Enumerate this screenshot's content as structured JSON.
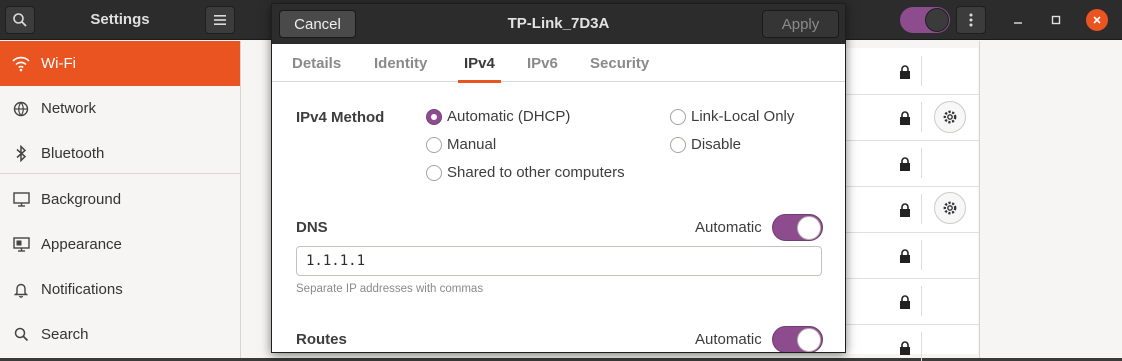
{
  "settings_window": {
    "title": "Settings",
    "sidebar_items": [
      {
        "label": "Wi-Fi",
        "icon": "wifi-icon",
        "active": true
      },
      {
        "label": "Network",
        "icon": "network-icon"
      },
      {
        "label": "Bluetooth",
        "icon": "bluetooth-icon"
      },
      {
        "label": "Background",
        "icon": "background-icon"
      },
      {
        "label": "Appearance",
        "icon": "appearance-icon"
      },
      {
        "label": "Notifications",
        "icon": "bell-icon"
      },
      {
        "label": "Search",
        "icon": "search-icon"
      }
    ]
  },
  "dialog": {
    "title": "TP-Link_7D3A",
    "cancel_label": "Cancel",
    "apply_label": "Apply",
    "tabs": [
      {
        "label": "Details"
      },
      {
        "label": "Identity"
      },
      {
        "label": "IPv4",
        "active": true
      },
      {
        "label": "IPv6"
      },
      {
        "label": "Security"
      }
    ],
    "ipv4_method": {
      "label": "IPv4 Method",
      "options": [
        {
          "label": "Automatic (DHCP)",
          "checked": true
        },
        {
          "label": "Manual",
          "checked": false
        },
        {
          "label": "Shared to other computers",
          "checked": false
        },
        {
          "label": "Link-Local Only",
          "checked": false
        },
        {
          "label": "Disable",
          "checked": false
        }
      ]
    },
    "dns": {
      "label": "DNS",
      "automatic_label": "Automatic",
      "automatic_on": true,
      "value": "1.1.1.1",
      "hint": "Separate IP addresses with commas"
    },
    "routes": {
      "label": "Routes",
      "automatic_label": "Automatic",
      "automatic_on": true
    }
  },
  "colors": {
    "accent": "#e95420",
    "toggle": "#8c4c8e",
    "headerbar": "#2c2c2c"
  }
}
